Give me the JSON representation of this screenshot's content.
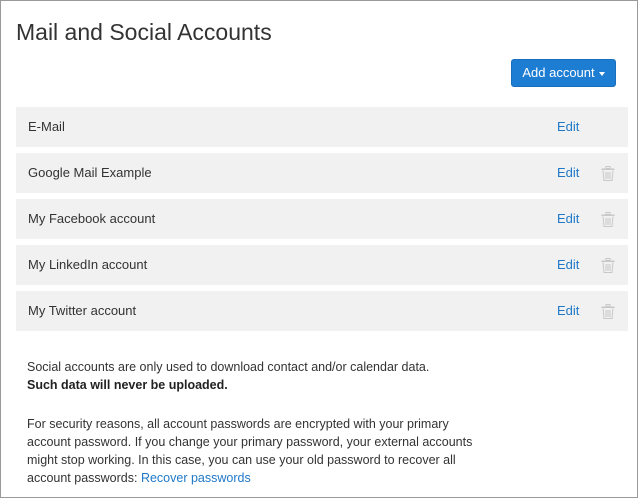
{
  "page": {
    "title": "Mail and Social Accounts"
  },
  "toolbar": {
    "add_account_label": "Add account"
  },
  "accounts": [
    {
      "name": "E-Mail",
      "edit_label": "Edit",
      "deletable": false
    },
    {
      "name": "Google Mail Example",
      "edit_label": "Edit",
      "deletable": true
    },
    {
      "name": "My Facebook account",
      "edit_label": "Edit",
      "deletable": true
    },
    {
      "name": "My LinkedIn account",
      "edit_label": "Edit",
      "deletable": true
    },
    {
      "name": "My Twitter account",
      "edit_label": "Edit",
      "deletable": true
    }
  ],
  "info": {
    "social_line": "Social accounts are only used to download contact and/or calendar data.",
    "social_bold": "Such data will never be uploaded.",
    "security_text": "For security reasons, all account passwords are encrypted with your primary account password. If you change your primary password, your external accounts might stop working. In this case, you can use your old password to recover all account passwords: ",
    "recover_link": "Recover passwords"
  },
  "icons": {
    "delete": "trash-icon",
    "dropdown": "caret-down-icon"
  },
  "colors": {
    "primary_button": "#1d7dd3",
    "link": "#1f79c8",
    "row_background": "#f1f1f1",
    "trash_icon": "#c8c8c8"
  }
}
